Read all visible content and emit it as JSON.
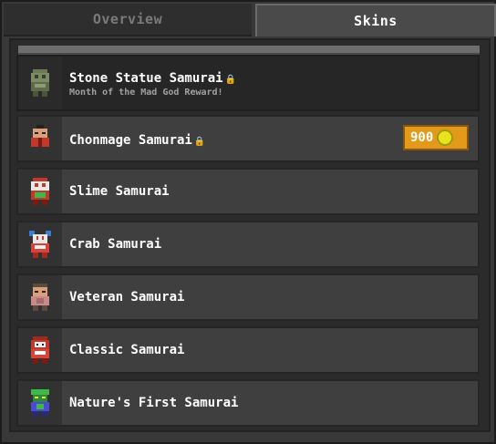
{
  "tabs": [
    {
      "label": "Overview",
      "active": false
    },
    {
      "label": "Skins",
      "active": true
    }
  ],
  "skins": [
    {
      "name": "Stone Statue Samurai",
      "locked": true,
      "subtitle": "Month of the Mad God Reward!",
      "icon": "stone-samurai-sprite"
    },
    {
      "name": "Chonmage Samurai",
      "locked": true,
      "price": "900",
      "icon": "chonmage-samurai-sprite"
    },
    {
      "name": "Slime Samurai",
      "locked": false,
      "icon": "slime-samurai-sprite"
    },
    {
      "name": "Crab Samurai",
      "locked": false,
      "icon": "crab-samurai-sprite"
    },
    {
      "name": "Veteran Samurai",
      "locked": false,
      "icon": "veteran-samurai-sprite"
    },
    {
      "name": "Classic Samurai",
      "locked": false,
      "icon": "classic-samurai-sprite"
    },
    {
      "name": "Nature's First Samurai",
      "locked": false,
      "icon": "nature-samurai-sprite"
    }
  ],
  "colors": {
    "accent_gold": "#e39a1b",
    "coin": "#e9e31d",
    "background": "#383838"
  }
}
